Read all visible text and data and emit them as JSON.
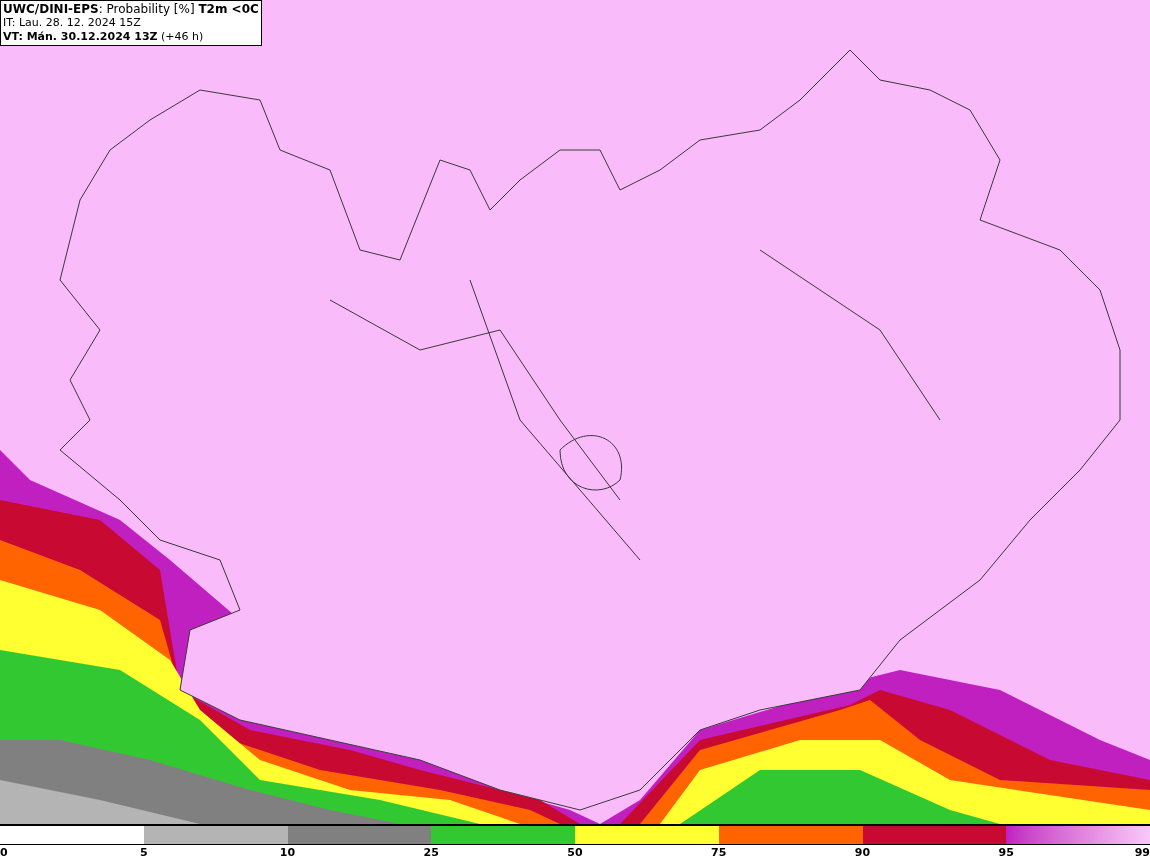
{
  "header": {
    "title": "**UWC/DINI-EPS**: Probability [%] **T2m <0C**",
    "init_line": "IT: Lau. 28. 12. 2024 15Z",
    "valid_line": "**VT: Mán. 30.12.2024 13Z** (+46 h)"
  },
  "legend": {
    "ticks": [
      "0",
      "5",
      "10",
      "25",
      "50",
      "75",
      "90",
      "95",
      "99"
    ],
    "bins": [
      {
        "color": "#ffffff"
      },
      {
        "color": "#b4b4b4"
      },
      {
        "color": "#808080"
      },
      {
        "color": "#32c832"
      },
      {
        "color": "#ffff32"
      },
      {
        "color": "#ff6400"
      },
      {
        "color": "#c80a32"
      },
      {
        "color": "#c020c0"
      }
    ]
  }
}
